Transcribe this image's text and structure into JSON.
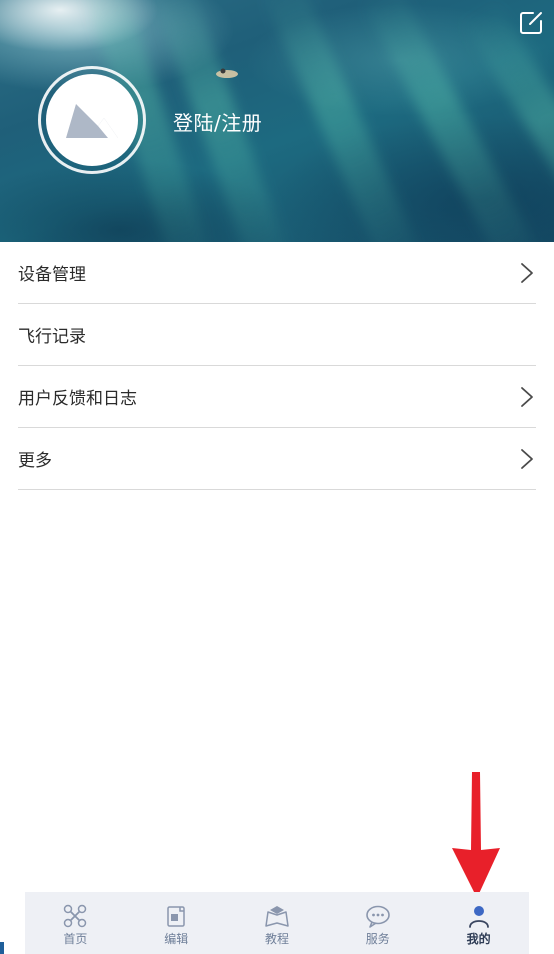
{
  "header": {
    "login_label": "登陆/注册",
    "edit_icon": "edit-icon",
    "avatar_icon": "avatar-placeholder-icon"
  },
  "menu": {
    "items": [
      {
        "label": "设备管理",
        "has_chevron": true
      },
      {
        "label": "飞行记录",
        "has_chevron": false
      },
      {
        "label": "用户反馈和日志",
        "has_chevron": true
      },
      {
        "label": "更多",
        "has_chevron": true
      }
    ]
  },
  "tabbar": {
    "tabs": [
      {
        "label": "首页",
        "icon": "drone-icon",
        "active": false
      },
      {
        "label": "编辑",
        "icon": "edit-media-icon",
        "active": false
      },
      {
        "label": "教程",
        "icon": "tutorial-cap-icon",
        "active": false
      },
      {
        "label": "服务",
        "icon": "chat-bubble-icon",
        "active": false
      },
      {
        "label": "我的",
        "icon": "person-icon",
        "active": true
      }
    ]
  },
  "colors": {
    "annotation_arrow": "#e8202a",
    "tab_inactive": "#6f7f99",
    "tab_active": "#2e3c55",
    "tabbar_bg": "#eef0f5"
  }
}
